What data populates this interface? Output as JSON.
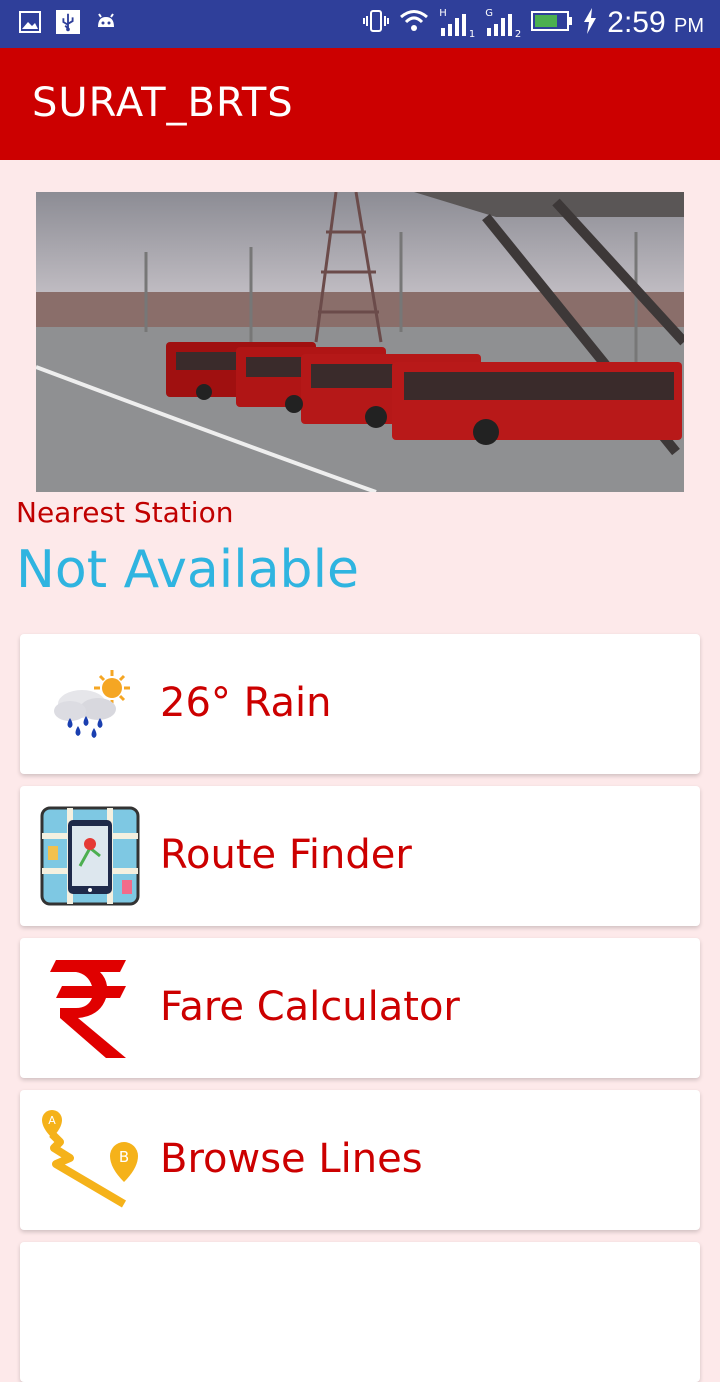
{
  "status_bar": {
    "time": "2:59",
    "ampm": "PM",
    "sim1": "H",
    "sim1_slot": "1",
    "sim2": "G",
    "sim2_slot": "2",
    "icons": [
      "image-icon",
      "usb-icon",
      "android-icon",
      "vibrate-icon",
      "wifi-icon",
      "signal-icon",
      "battery-icon",
      "charging-icon"
    ]
  },
  "app_bar": {
    "title": "SURAT_BRTS"
  },
  "banner": {
    "image": "brts-buses-photo"
  },
  "nearest_station": {
    "label": "Nearest Station",
    "value": "Not Available"
  },
  "menu": [
    {
      "label": "26° Rain",
      "icon": "weather-rain-icon"
    },
    {
      "label": "Route Finder",
      "icon": "route-map-icon"
    },
    {
      "label": "Fare Calculator",
      "icon": "rupee-icon"
    },
    {
      "label": "Browse Lines",
      "icon": "path-a-b-icon"
    }
  ],
  "colors": {
    "status_bar": "#2f3f9a",
    "app_bar": "#cc0000",
    "background": "#fde9ea",
    "accent_blue": "#2fb4e0",
    "text_red": "#cc0000"
  }
}
